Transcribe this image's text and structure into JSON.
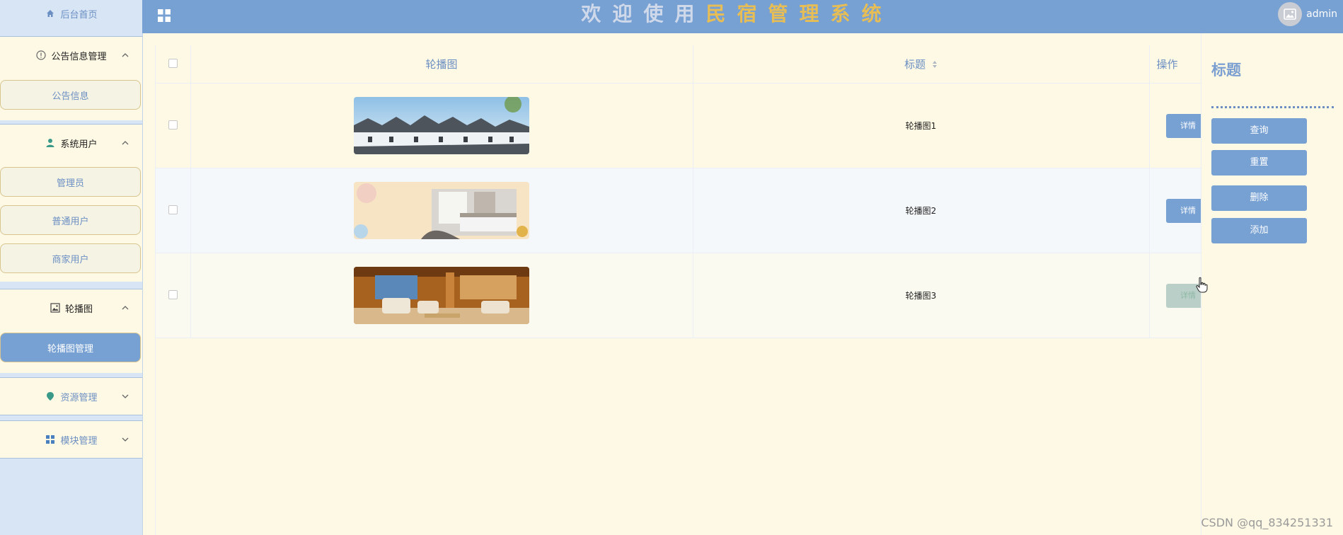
{
  "header": {
    "title_chars": [
      "欢",
      "迎",
      "使",
      "用",
      "民",
      "宿",
      "管",
      "理",
      "系",
      "统"
    ],
    "user": "admin"
  },
  "sidebar": {
    "home": "后台首页",
    "groups": [
      {
        "label": "公告信息管理",
        "items": [
          "公告信息"
        ]
      },
      {
        "label": "系统用户",
        "items": [
          "管理员",
          "普通用户",
          "商家用户"
        ]
      },
      {
        "label": "轮播图",
        "items": [
          "轮播图管理"
        ]
      },
      {
        "label": "资源管理"
      },
      {
        "label": "模块管理"
      }
    ]
  },
  "table": {
    "headers": {
      "image": "轮播图",
      "title": "标题",
      "action": "操作"
    },
    "rows": [
      {
        "title": "轮播图1",
        "action": "详情"
      },
      {
        "title": "轮播图2",
        "action": "详情"
      },
      {
        "title": "轮播图3",
        "action": "详情"
      }
    ]
  },
  "panel": {
    "title": "标题",
    "buttons": {
      "query": "查询",
      "reset": "重置",
      "delete": "删除",
      "add": "添加"
    }
  },
  "watermark": "CSDN @qq_834251331",
  "colors": {
    "primary": "#77a0d3",
    "background": "#fef9e4",
    "sidebar": "#d7e5f4",
    "title_gold": "#e6be55",
    "title_light": "#cfd9ea"
  }
}
